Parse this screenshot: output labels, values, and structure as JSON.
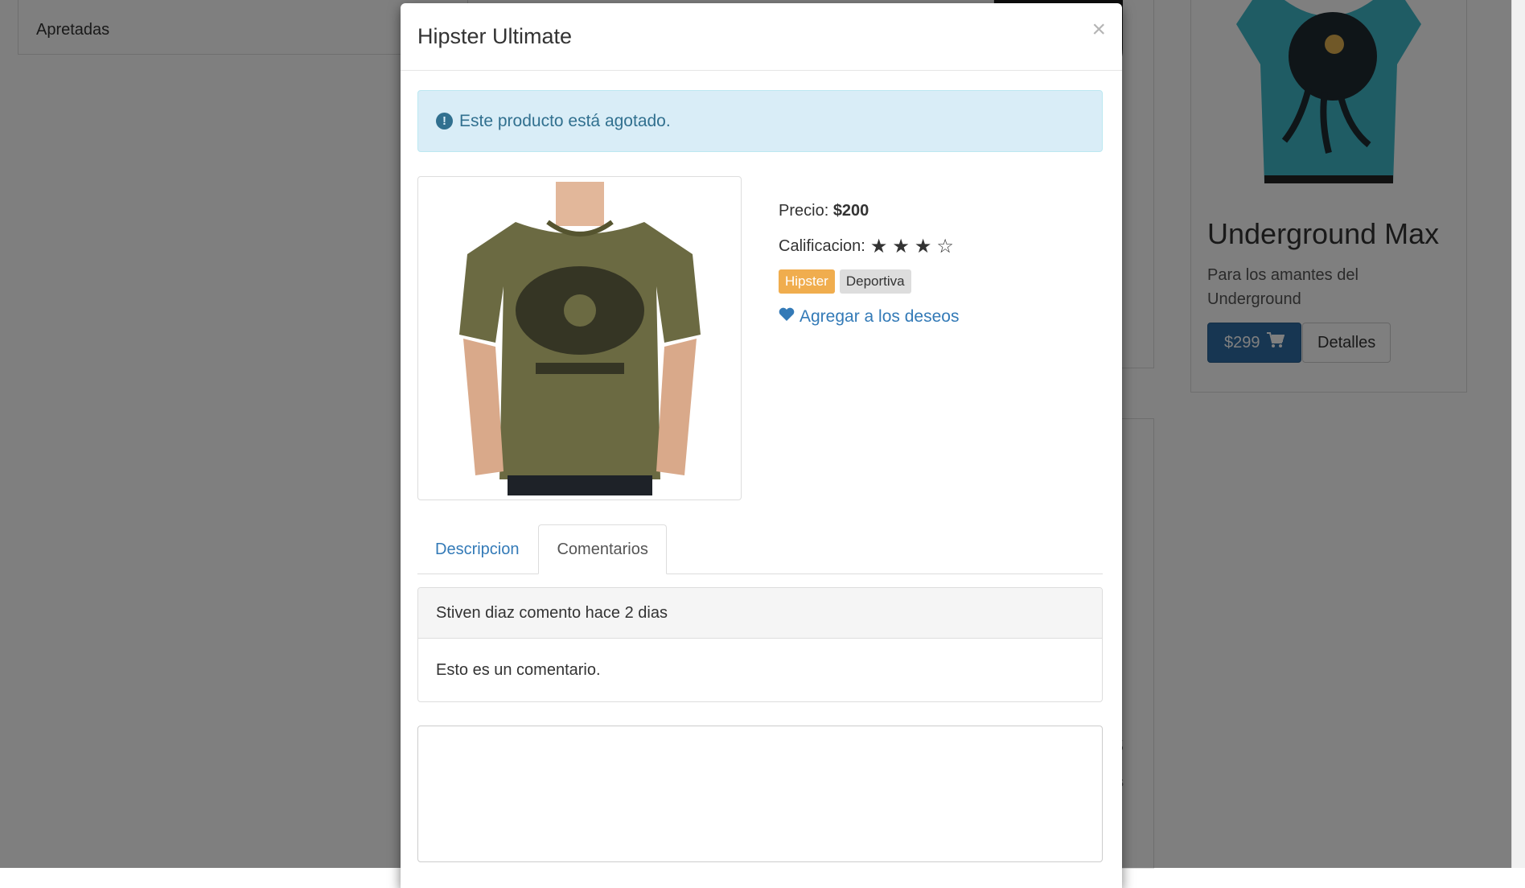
{
  "background": {
    "sidebar_item": "Apretadas",
    "product_card": {
      "title": "Underground Max",
      "description": "Para los amantes del Underground",
      "price_button": "$299",
      "details_button": "Detalles"
    },
    "partial_text": "s",
    "partial_small": "s"
  },
  "modal": {
    "title": "Hipster Ultimate",
    "close_label": "×",
    "alert_text": "Este producto está agotado.",
    "price_label": "Precio:",
    "price_value": "$200",
    "rating_label": "Calificacion:",
    "rating": 3,
    "rating_max": 4,
    "stars_text": "★★★☆",
    "tags": [
      "Hipster",
      "Deportiva"
    ],
    "wishlist_link": "Agregar a los deseos",
    "tabs": [
      {
        "label": "Descripcion",
        "active": false
      },
      {
        "label": "Comentarios",
        "active": true
      }
    ],
    "comment": {
      "heading": "Stiven diaz comento hace 2 dias",
      "body": "Esto es un comentario."
    },
    "comment_input_value": ""
  },
  "colors": {
    "primary": "#337ab7",
    "alert_bg": "#d9edf7",
    "alert_text": "#31708f",
    "label_warning": "#f0ad4e",
    "shirt_olive": "#6b6a42",
    "shirt_teal": "#3fb8c9"
  },
  "icons": [
    "exclamation-circle-icon",
    "heart-icon",
    "shopping-cart-icon",
    "close-icon"
  ]
}
